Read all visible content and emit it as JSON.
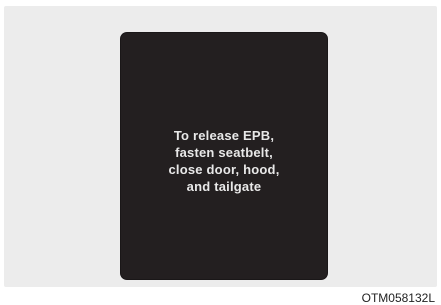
{
  "display": {
    "message_lines": [
      "To release EPB,",
      "fasten seatbelt,",
      "close door, hood,",
      "and tailgate"
    ]
  },
  "figure": {
    "code": "OTM058132L"
  },
  "colors": {
    "panel_background": "#ececec",
    "display_background": "#231f20",
    "display_text": "#e8e8e8"
  }
}
